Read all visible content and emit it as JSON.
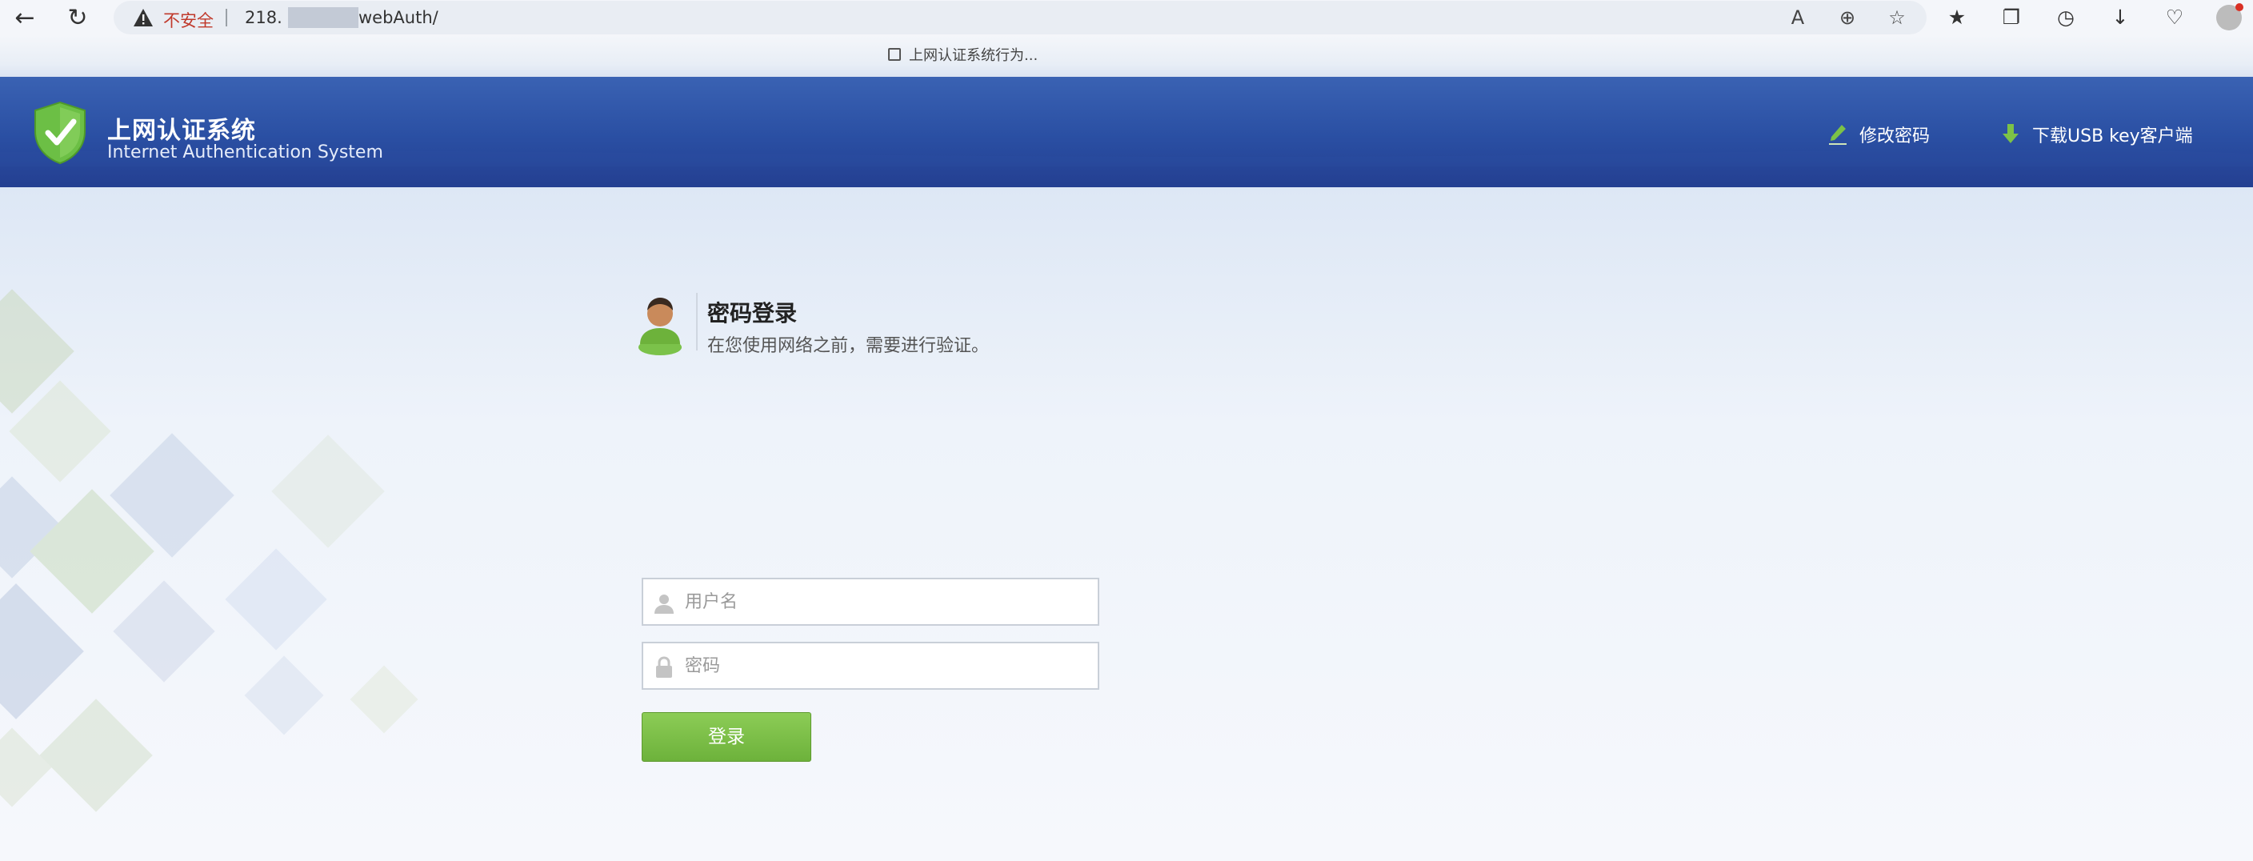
{
  "browser": {
    "insecure_label": "不安全",
    "url_prefix": "218.",
    "url_suffix": "webAuth/",
    "bookmarks": [
      {
        "label": "上网认证系统行为..."
      }
    ]
  },
  "header": {
    "title_cn": "上网认证系统",
    "title_en": "Internet Authentication System",
    "change_password": "修改密码",
    "download_usb": "下载USB key客户端"
  },
  "login": {
    "title": "密码登录",
    "subtitle": "在您使用网络之前，需要进行验证。",
    "username_placeholder": "用户名",
    "password_placeholder": "密码",
    "submit_label": "登录"
  },
  "colors": {
    "header": "#2a4fa3",
    "button": "#6db23b",
    "insecure": "#c0392b"
  }
}
